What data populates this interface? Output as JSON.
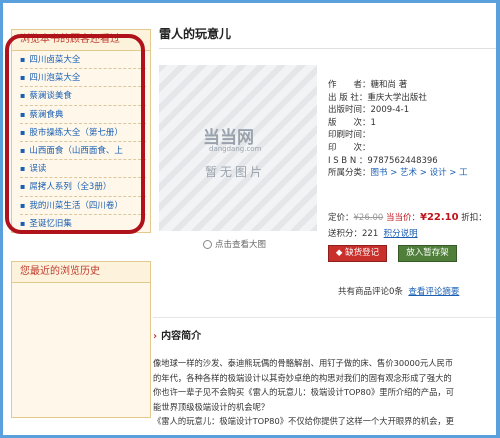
{
  "sidebar": {
    "also_viewed_title": "浏览本书的顾客还看过",
    "items": [
      {
        "label": "四川卤菜大全"
      },
      {
        "label": "四川泡菜大全"
      },
      {
        "label": "蔡澜谈美食"
      },
      {
        "label": "蔡澜食典"
      },
      {
        "label": "股市操练大全（第七册）"
      },
      {
        "label": "山西面食（山西面食、上"
      },
      {
        "label": "误读"
      },
      {
        "label": "屌拷人系列（全3册）"
      },
      {
        "label": "我的川菜生活（四川卷）"
      },
      {
        "label": "圣诞忆旧集"
      }
    ],
    "history_title": "您最近的浏览历史"
  },
  "product": {
    "title": "雷人的玩意儿",
    "cover_logo": "当当网",
    "cover_logo_sub": "dangdang.com",
    "cover_noimage": "暂无图片",
    "zoom_label": "点击查看大图",
    "info": [
      {
        "label": "作　　者：",
        "value": "糖和尚 著"
      },
      {
        "label": "出 版 社：",
        "value": "重庆大学出版社"
      },
      {
        "label": "出版时间：",
        "value": "2009-4-1"
      },
      {
        "label": "版　　次：",
        "value": "1"
      },
      {
        "label": "印刷时间：",
        "value": ""
      },
      {
        "label": "印　　次：",
        "value": ""
      },
      {
        "label": "I S B N ：",
        "value": "9787562448396"
      }
    ],
    "category_label": "所属分类：",
    "category_path": "图书 > 艺术 > 设计 > 工",
    "price_label": "定价：",
    "price_old": "¥26.00",
    "price_cur_label": "当当价：",
    "price_cur": "¥22.10",
    "discount_label": "折扣：",
    "points_text": "送积分：221",
    "points_link": "积分说明",
    "cart_button": "缺货登记",
    "hold_button": "放入暂存架",
    "reviews_text": "共有商品评论0条",
    "reviews_link": "查看评论摘要"
  },
  "content": {
    "section_title": "内容简介",
    "lines": [
      "像地球一样的沙发、泰迪熊玩偶的骨骼解剖、用钉子做的床、售价30000元人民币",
      "的年代，各种各样的极端设计以其奇妙卓绝的构思对我们的固有观念形成了强大的",
      "你也许一辈子见不会购买《雷人的玩意儿：极端设计TOP80》里所介绍的产品，可",
      "能世界顶级极端设计的机会呢？",
      "《雷人的玩意儿：极端设计TOP80》不仅给你提供了这样一个大开眼界的机会，更"
    ]
  }
}
